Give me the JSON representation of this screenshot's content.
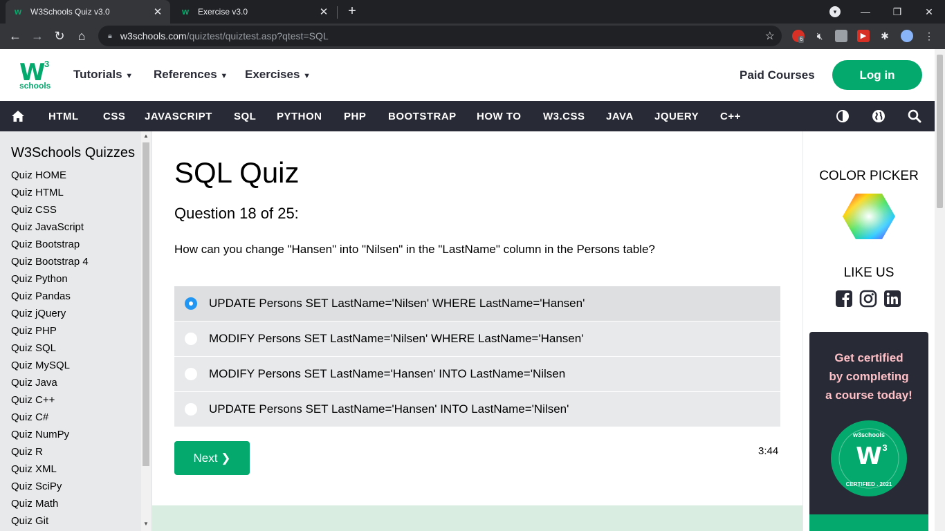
{
  "browser": {
    "tabs": [
      {
        "title": "W3Schools Quiz v3.0",
        "active": true
      },
      {
        "title": "Exercise v3.0",
        "active": false
      }
    ],
    "url_host": "w3schools.com",
    "url_path": "/quiztest/quiztest.asp?qtest=SQL",
    "extension_badge": "6"
  },
  "site": {
    "logo_mark": "W",
    "logo_superscript": "3",
    "logo_word": "schools",
    "menus": [
      "Tutorials",
      "References",
      "Exercises"
    ],
    "paid_courses": "Paid Courses",
    "login": "Log in",
    "topics": [
      "HTML",
      "CSS",
      "JAVASCRIPT",
      "SQL",
      "PYTHON",
      "PHP",
      "BOOTSTRAP",
      "HOW TO",
      "W3.CSS",
      "JAVA",
      "JQUERY",
      "C++"
    ]
  },
  "sidebar": {
    "title": "W3Schools Quizzes",
    "items": [
      "Quiz HOME",
      "Quiz HTML",
      "Quiz CSS",
      "Quiz JavaScript",
      "Quiz Bootstrap",
      "Quiz Bootstrap 4",
      "Quiz Python",
      "Quiz Pandas",
      "Quiz jQuery",
      "Quiz PHP",
      "Quiz SQL",
      "Quiz MySQL",
      "Quiz Java",
      "Quiz C++",
      "Quiz C#",
      "Quiz NumPy",
      "Quiz R",
      "Quiz XML",
      "Quiz SciPy",
      "Quiz Math",
      "Quiz Git"
    ]
  },
  "quiz": {
    "title": "SQL Quiz",
    "question_number": "Question 18 of 25:",
    "question": "How can you change \"Hansen\" into \"Nilsen\" in the \"LastName\" column in the Persons table?",
    "options": [
      "UPDATE Persons SET LastName='Nilsen' WHERE LastName='Hansen'",
      "MODIFY Persons SET LastName='Nilsen' WHERE LastName='Hansen'",
      "MODIFY Persons SET LastName='Hansen' INTO LastName='Nilsen",
      "UPDATE Persons SET LastName='Hansen' INTO LastName='Nilsen'"
    ],
    "selected_index": 0,
    "next_label": "Next ❯",
    "timer": "3:44"
  },
  "right": {
    "color_picker": "COLOR PICKER",
    "like_us": "LIKE US",
    "cert_line1": "Get certified",
    "cert_line2": "by completing",
    "cert_line3": "a course today!",
    "badge_top": "w3schools",
    "badge_bottom": "CERTIFIED . 2021",
    "badge_mark": "W",
    "badge_sup": "3"
  },
  "colors": {
    "brand_green": "#04aa6d",
    "dark_nav": "#282a35",
    "sidebar_bg": "#e7e9eb",
    "radio_blue": "#2196f3",
    "cert_text": "#ffc0c7"
  }
}
